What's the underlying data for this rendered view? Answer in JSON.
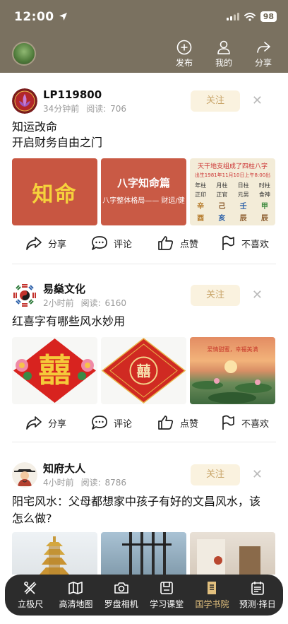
{
  "status": {
    "time": "12:00",
    "battery": "98"
  },
  "header": {
    "actions": [
      {
        "label": "发布",
        "icon": "plus-circle-icon"
      },
      {
        "label": "我的",
        "icon": "user-icon"
      },
      {
        "label": "分享",
        "icon": "share-arrow-icon"
      }
    ]
  },
  "posts": [
    {
      "author": "LP119800",
      "time": "34分钟前",
      "reads_label": "阅读:",
      "reads": "706",
      "follow": "关注",
      "title_lines": [
        "知运改命",
        "开启财务自由之门"
      ],
      "thumbs": {
        "t1": "知命",
        "t2_title": "八字知命篇",
        "t2_sub": "八字整体格局—— 财运/健",
        "t3_head": "天干地支组成了四柱八字",
        "t3_sub": "出生1981年11月10日上午8:00出",
        "t3_cols": [
          "年柱",
          "月柱",
          "日柱",
          "时柱"
        ],
        "t3_gods": [
          "正印",
          "正官",
          "元男",
          "食神"
        ],
        "t3_stems": [
          "辛",
          "己",
          "壬",
          "甲"
        ],
        "t3_branches": [
          "酉",
          "亥",
          "辰",
          "辰"
        ]
      }
    },
    {
      "author": "易燊文化",
      "time": "2小时前",
      "reads_label": "阅读:",
      "reads": "6160",
      "follow": "关注",
      "title_lines": [
        "红喜字有哪些风水妙用"
      ],
      "thumbs": {
        "t1": "囍",
        "t2": "囍",
        "t3": "爱情甜蜜，幸福美满"
      }
    },
    {
      "author": "知府大人",
      "time": "4小时前",
      "reads_label": "阅读:",
      "reads": "8786",
      "follow": "关注",
      "title_lines": [
        "阳宅风水：父母都想家中孩子有好的文昌风水，该",
        "怎么做?"
      ]
    }
  ],
  "actions": {
    "share": "分享",
    "comment": "评论",
    "like": "点赞",
    "dislike": "不喜欢"
  },
  "tabbar": [
    {
      "label": "立极尺",
      "icon": "ruler-icon"
    },
    {
      "label": "高清地图",
      "icon": "map-icon"
    },
    {
      "label": "罗盘相机",
      "icon": "camera-icon"
    },
    {
      "label": "学习课堂",
      "icon": "book-save-icon"
    },
    {
      "label": "国学书院",
      "icon": "scroll-icon",
      "active": true
    },
    {
      "label": "预测·择日",
      "icon": "calendar-list-icon"
    }
  ],
  "colors": {
    "header_bg": "#7a7160",
    "accent": "#e2c07e",
    "follow_text": "#c9a66b",
    "tabbar_bg": "#2c2c2c"
  }
}
